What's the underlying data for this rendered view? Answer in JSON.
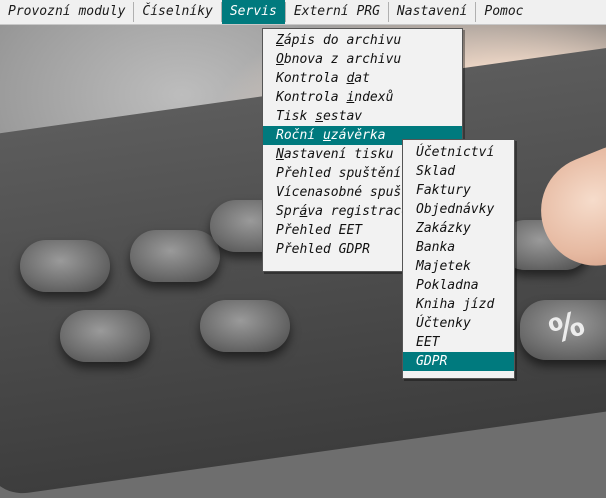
{
  "menubar": {
    "items": [
      {
        "label": "Provozní moduly"
      },
      {
        "label": "Číselníky"
      },
      {
        "label": "Servis"
      },
      {
        "label": "Externí PRG"
      },
      {
        "label": "Nastavení"
      },
      {
        "label": "Pomoc"
      }
    ]
  },
  "servis_menu": {
    "items": [
      {
        "pre": "",
        "u": "Z",
        "post": "ápis do archivu"
      },
      {
        "pre": "",
        "u": "O",
        "post": "bnova z archivu"
      },
      {
        "pre": "Kontrola ",
        "u": "d",
        "post": "at"
      },
      {
        "pre": "Kontrola ",
        "u": "i",
        "post": "ndexů"
      },
      {
        "pre": "Tisk ",
        "u": "s",
        "post": "estav"
      },
      {
        "pre": "Roční ",
        "u": "u",
        "post": "závěrka"
      },
      {
        "pre": "",
        "u": "N",
        "post": "astavení tisku"
      },
      {
        "pre": "",
        "u": "",
        "post": "Přehled spuštění"
      },
      {
        "pre": "",
        "u": "",
        "post": "Vícenasobné spuštění"
      },
      {
        "pre": "Spr",
        "u": "á",
        "post": "va registrace"
      },
      {
        "pre": "",
        "u": "",
        "post": "Přehled EET"
      },
      {
        "pre": "",
        "u": "",
        "post": "Přehled GDPR"
      }
    ],
    "active_index": 5
  },
  "uzaverka_submenu": {
    "items": [
      "Účetnictví",
      "Sklad",
      "Faktury",
      "Objednávky",
      "Zakázky",
      "Banka",
      "Majetek",
      "Pokladna",
      "Kniha jízd",
      "Účtenky",
      "EET",
      "GDPR"
    ],
    "active_index": 11
  },
  "colors": {
    "accent": "#007a7e",
    "menu_bg": "#f2f2f2"
  },
  "background": {
    "key_symbols": [
      "%",
      "·",
      "+"
    ]
  }
}
